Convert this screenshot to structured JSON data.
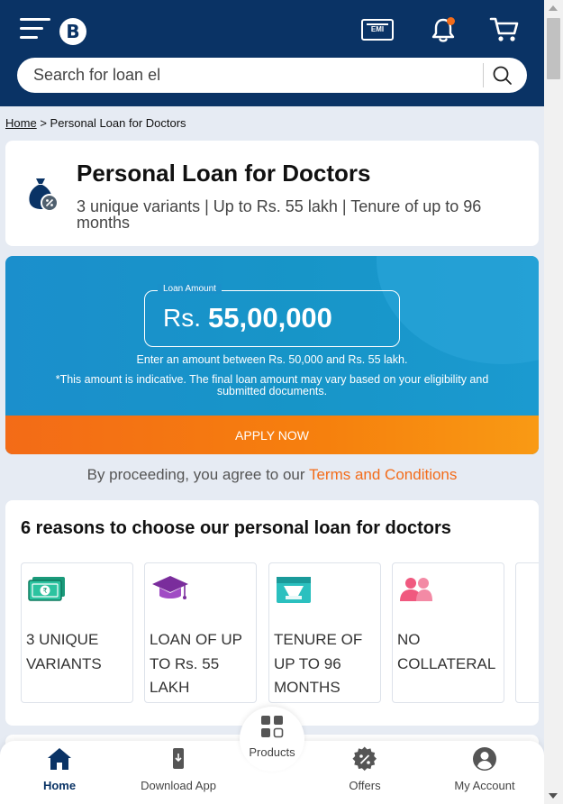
{
  "header": {
    "logo_text": "B",
    "emi_label": "EMI",
    "search": {
      "placeholder": "Search for loan el",
      "value": ""
    },
    "colors": {
      "background": "#0a3365",
      "notification_dot": "#f36c1a"
    }
  },
  "breadcrumb": {
    "home_label": "Home",
    "separator": ">",
    "current": "Personal Loan for Doctors"
  },
  "product": {
    "title": "Personal Loan for Doctors",
    "subtitle": "3 unique variants | Up to Rs. 55 lakh | Tenure of up to 96 months",
    "icon": "money-bag-percent-icon"
  },
  "loan_amount": {
    "label": "Loan Amount",
    "currency": "Rs.",
    "value": "55,00,000",
    "range_text": "Enter an amount between Rs. 50,000 and Rs. 55 lakh.",
    "note": "*This amount is indicative. The final loan amount may vary based on your eligibility and submitted documents.",
    "apply_label": "APPLY NOW"
  },
  "terms": {
    "prefix": "By proceeding, you agree to our",
    "link": "Terms and Conditions"
  },
  "reasons": {
    "title": "6 reasons to choose our personal loan for doctors",
    "items": [
      {
        "label": "3 UNIQUE VARIANTS",
        "icon": "banknote-rupee-icon"
      },
      {
        "label": "LOAN OF UP TO Rs. 55 LAKH",
        "icon": "graduation-cap-icon"
      },
      {
        "label": "TENURE OF UP TO 96 MONTHS",
        "icon": "calendar-icon"
      },
      {
        "label": "NO COLLATERAL",
        "icon": "people-icon"
      }
    ]
  },
  "bottom_nav": {
    "home": "Home",
    "download": "Download App",
    "products": "Products",
    "offers": "Offers",
    "account": "My Account"
  }
}
